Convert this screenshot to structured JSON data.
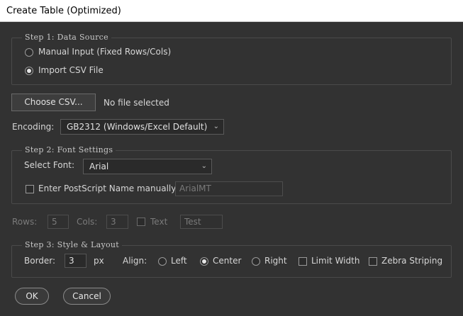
{
  "window": {
    "title": "Create Table (Optimized)"
  },
  "step1": {
    "legend": "Step 1: Data Source",
    "option_manual": "Manual Input (Fixed Rows/Cols)",
    "option_csv": "Import CSV File",
    "selected": "csv"
  },
  "csv": {
    "choose_label": "Choose CSV...",
    "status": "No file selected"
  },
  "encoding": {
    "label": "Encoding:",
    "value": "GB2312 (Windows/Excel Default)"
  },
  "step2": {
    "legend": "Step 2: Font Settings",
    "font_label": "Select Font:",
    "font_value": "Arial",
    "postscript_label": "Enter PostScript Name manually:",
    "postscript_value": "ArialMT",
    "postscript_checked": false
  },
  "grid": {
    "rows_label": "Rows:",
    "rows_value": "5",
    "cols_label": "Cols:",
    "cols_value": "3",
    "text_label": "Text",
    "text_value": "Test",
    "text_checked": false
  },
  "step3": {
    "legend": "Step 3: Style & Layout",
    "border_label": "Border:",
    "border_value": "3",
    "border_unit": "px",
    "align_label": "Align:",
    "align_left": "Left",
    "align_center": "Center",
    "align_right": "Right",
    "align_selected": "center",
    "limit_width_label": "Limit Width",
    "zebra_label": "Zebra Striping"
  },
  "buttons": {
    "ok": "OK",
    "cancel": "Cancel"
  }
}
